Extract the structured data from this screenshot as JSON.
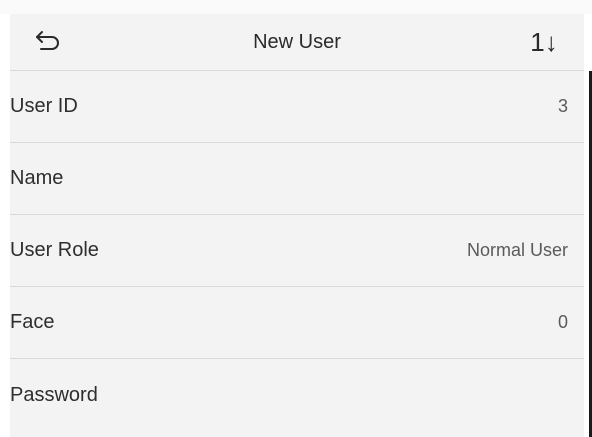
{
  "header": {
    "back_icon": "back-arrow-icon",
    "title": "New User",
    "sort_label": "1↓",
    "sort_icon": "sort-icon"
  },
  "rows": [
    {
      "label": "User ID",
      "value": "3"
    },
    {
      "label": "Name",
      "value": ""
    },
    {
      "label": "User Role",
      "value": "Normal User"
    },
    {
      "label": "Face",
      "value": "0"
    },
    {
      "label": "Password",
      "value": ""
    }
  ]
}
